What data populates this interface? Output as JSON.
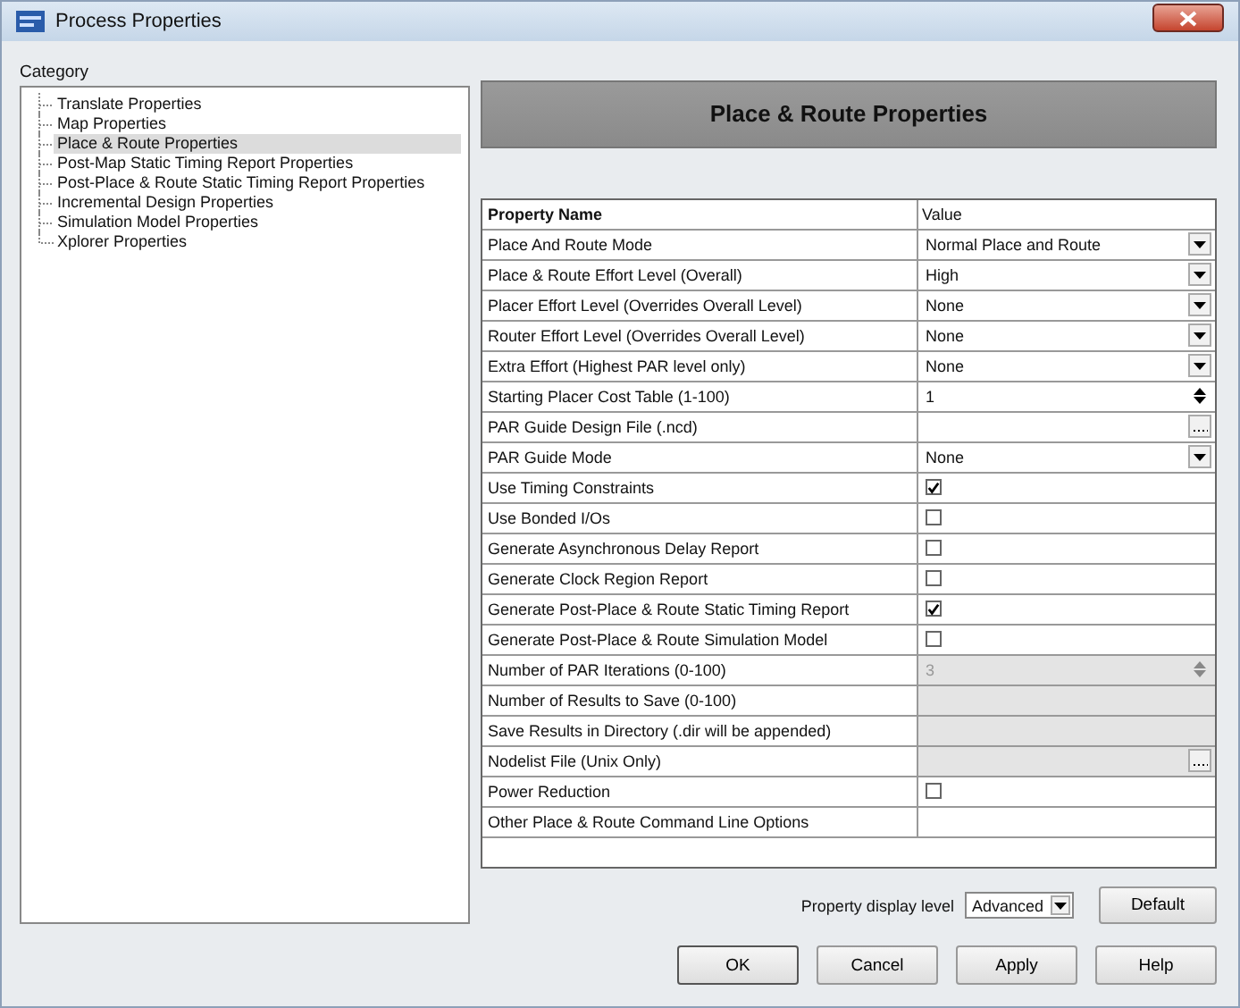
{
  "window": {
    "title": "Process Properties"
  },
  "category": {
    "label": "Category",
    "items": [
      {
        "label": "Translate Properties",
        "selected": false
      },
      {
        "label": "Map Properties",
        "selected": false
      },
      {
        "label": "Place & Route Properties",
        "selected": true
      },
      {
        "label": "Post-Map Static Timing Report Properties",
        "selected": false
      },
      {
        "label": "Post-Place & Route Static Timing Report Properties",
        "selected": false
      },
      {
        "label": "Incremental Design Properties",
        "selected": false
      },
      {
        "label": "Simulation Model Properties",
        "selected": false
      },
      {
        "label": "Xplorer Properties",
        "selected": false
      }
    ]
  },
  "panel_title": "Place & Route Properties",
  "table": {
    "columns": [
      "Property Name",
      "Value"
    ],
    "rows": [
      {
        "name": "Place And Route Mode",
        "kind": "dropdown",
        "value": "Normal Place and Route",
        "disabled": false
      },
      {
        "name": "Place & Route Effort Level (Overall)",
        "kind": "dropdown",
        "value": "High",
        "disabled": false
      },
      {
        "name": "Placer Effort Level (Overrides Overall Level)",
        "kind": "dropdown",
        "value": "None",
        "disabled": false
      },
      {
        "name": "Router Effort Level (Overrides Overall Level)",
        "kind": "dropdown",
        "value": "None",
        "disabled": false
      },
      {
        "name": "Extra Effort (Highest PAR level only)",
        "kind": "dropdown",
        "value": "None",
        "disabled": false
      },
      {
        "name": "Starting Placer Cost Table (1-100)",
        "kind": "spin",
        "value": "1",
        "disabled": false
      },
      {
        "name": "PAR Guide Design File (.ncd)",
        "kind": "browse",
        "disabled": false
      },
      {
        "name": "PAR Guide Mode",
        "kind": "dropdown",
        "value": "None",
        "disabled": false
      },
      {
        "name": "Use Timing Constraints",
        "kind": "checkbox",
        "checked": true,
        "disabled": false
      },
      {
        "name": "Use Bonded I/Os",
        "kind": "checkbox",
        "checked": false,
        "disabled": false
      },
      {
        "name": "Generate Asynchronous Delay Report",
        "kind": "checkbox",
        "checked": false,
        "disabled": false
      },
      {
        "name": "Generate Clock Region Report",
        "kind": "checkbox",
        "checked": false,
        "disabled": false
      },
      {
        "name": "Generate Post-Place & Route Static Timing Report",
        "kind": "checkbox",
        "checked": true,
        "disabled": false
      },
      {
        "name": "Generate Post-Place & Route Simulation Model",
        "kind": "checkbox",
        "checked": false,
        "disabled": false
      },
      {
        "name": "Number of PAR Iterations (0-100)",
        "kind": "spin",
        "value": "3",
        "disabled": true
      },
      {
        "name": "Number of Results to Save (0-100)",
        "kind": "text",
        "disabled": true
      },
      {
        "name": "Save Results in Directory (.dir will be appended)",
        "kind": "text",
        "disabled": true
      },
      {
        "name": "Nodelist File (Unix Only)",
        "kind": "browse",
        "disabled": true
      },
      {
        "name": "Power Reduction",
        "kind": "checkbox",
        "checked": false,
        "disabled": false
      },
      {
        "name": "Other Place & Route Command Line Options",
        "kind": "text",
        "disabled": false
      }
    ]
  },
  "display_level": {
    "label": "Property display level",
    "value": "Advanced"
  },
  "default_button": "Default",
  "buttons": [
    "OK",
    "Cancel",
    "Apply",
    "Help"
  ]
}
